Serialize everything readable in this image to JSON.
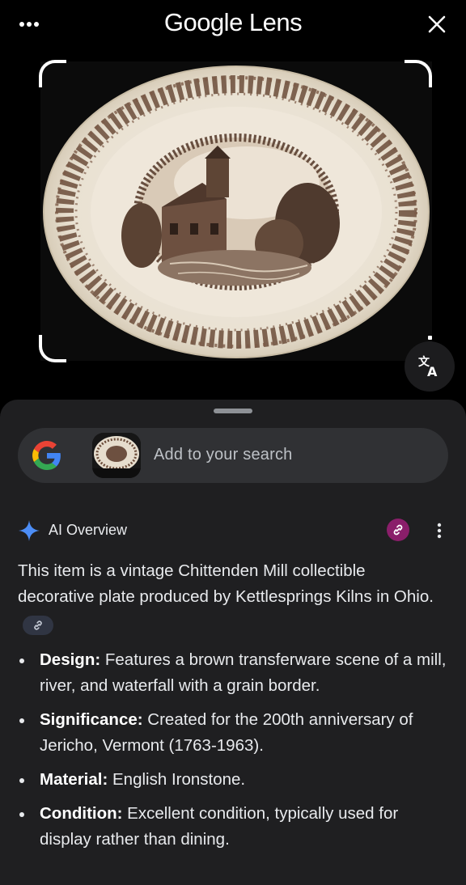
{
  "header": {
    "title": "Google Lens",
    "more_icon": "more-horizontal-icon",
    "close_icon": "close-icon"
  },
  "image": {
    "description_icon": "plate-photo",
    "translate_icon": "translate-icon"
  },
  "search": {
    "placeholder": "Add to your search",
    "logo": "google-g-logo"
  },
  "ai_overview": {
    "label": "AI Overview",
    "summary": "This item is a vintage Chittenden Mill collectible decorative plate produced by Kettlesprings Kilns in Ohio.",
    "bullets": [
      {
        "term": "Design:",
        "text": " Features a brown transferware scene of a mill, river, and waterfall with a grain border."
      },
      {
        "term": "Significance:",
        "text": " Created for the 200th anniversary of Jericho, Vermont (1763-1963)."
      },
      {
        "term": "Material:",
        "text": " English Ironstone."
      },
      {
        "term": "Condition:",
        "text": " Excellent condition, typically used for display rather than dining."
      }
    ]
  },
  "colors": {
    "background": "#000000",
    "sheet": "#1f1f21",
    "search_bar": "#303134",
    "link_chip": "#8a1e6a",
    "sparkle": "#4c8df6"
  }
}
